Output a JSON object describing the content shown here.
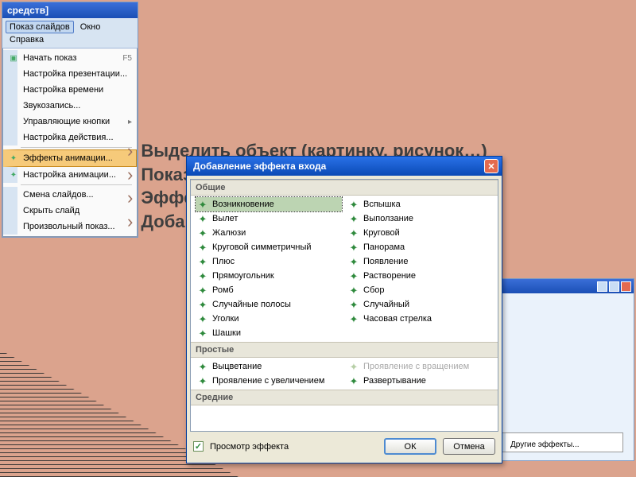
{
  "title_fragment": "средств]",
  "menubar": {
    "slideshow": "Показ слайдов",
    "window": "Окно",
    "help": "Справка"
  },
  "menu": {
    "items": [
      {
        "label": "Начать показ",
        "shortcut": "F5",
        "icon": "▣"
      },
      {
        "label": "Настройка презентации...",
        "shortcut": "",
        "icon": ""
      },
      {
        "label": "Настройка времени",
        "shortcut": "",
        "icon": ""
      },
      {
        "label": "Звукозапись...",
        "shortcut": "",
        "icon": ""
      },
      {
        "label": "Управляющие кнопки",
        "shortcut": "▸",
        "icon": ""
      },
      {
        "label": "Настройка действия...",
        "shortcut": "",
        "icon": ""
      },
      {
        "label": "Эффекты анимации...",
        "shortcut": "",
        "icon": "✦",
        "hl": true
      },
      {
        "label": "Настройка анимации...",
        "shortcut": "",
        "icon": "✦"
      },
      {
        "label": "Смена слайдов...",
        "shortcut": "",
        "icon": ""
      },
      {
        "label": "Скрыть слайд",
        "shortcut": "",
        "icon": ""
      },
      {
        "label": "Произвольный показ...",
        "shortcut": "",
        "icon": ""
      }
    ]
  },
  "bullets": [
    "Выделить объект (картинку, рисунок…)",
    "Показ сла",
    "Эффекты",
    "Добавить"
  ],
  "dialog": {
    "title": "Добавление эффекта входа",
    "groups": [
      {
        "name": "Общие",
        "effects_left": [
          "Возникновение",
          "Вылет",
          "Жалюзи",
          "Круговой симметричный",
          "Плюс",
          "Прямоугольник",
          "Ромб",
          "Случайные полосы",
          "Уголки",
          "Шашки"
        ],
        "effects_right": [
          "Вспышка",
          "Выползание",
          "Круговой",
          "Панорама",
          "Появление",
          "Растворение",
          "Сбор",
          "Случайный",
          "Часовая стрелка",
          ""
        ],
        "selected": "Возникновение"
      },
      {
        "name": "Простые",
        "effects_left": [
          "Выцветание",
          "Проявление с увеличением"
        ],
        "effects_right": [
          "Проявление с вращением",
          "Развертывание"
        ],
        "disabled": "Проявление с вращением"
      },
      {
        "name": "Средние",
        "effects_left": [],
        "effects_right": []
      }
    ],
    "preview_label": "Просмотр эффекта",
    "preview_checked": true,
    "ok": "ОК",
    "cancel": "Отмена"
  },
  "bg_small_menu": [
    "",
    "Другие эффекты..."
  ]
}
